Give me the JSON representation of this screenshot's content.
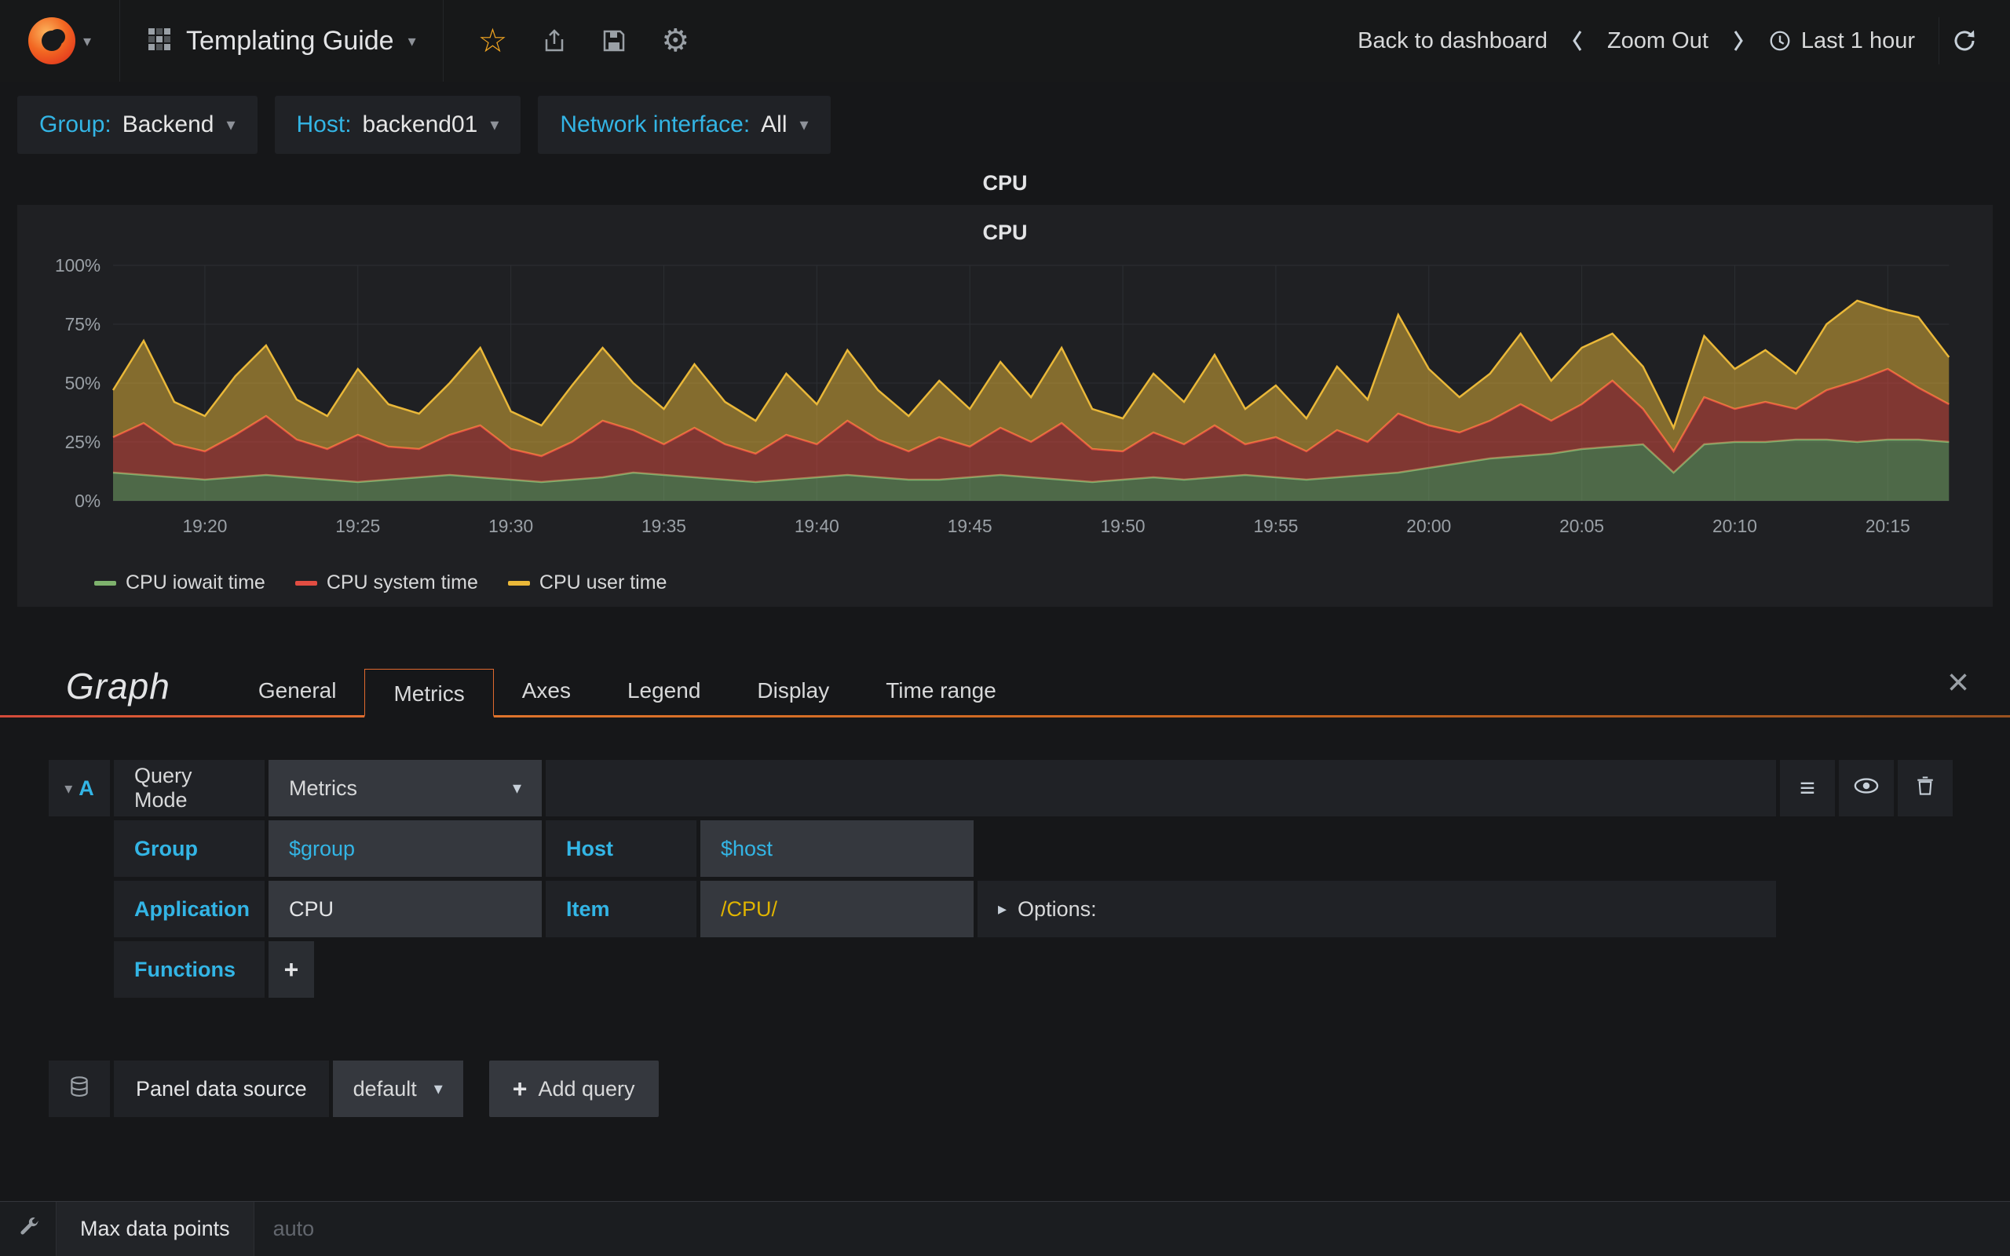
{
  "navbar": {
    "title": "Templating Guide",
    "back_to_dashboard": "Back to dashboard",
    "zoom_out": "Zoom Out",
    "time_range": "Last 1 hour"
  },
  "variables": [
    {
      "label": "Group:",
      "value": "Backend"
    },
    {
      "label": "Host:",
      "value": "backend01"
    },
    {
      "label": "Network interface:",
      "value": "All"
    }
  ],
  "panel": {
    "header_title": "CPU",
    "chart_title": "CPU"
  },
  "chart_data": {
    "type": "area",
    "stacked": true,
    "title": "CPU",
    "ylim": [
      0,
      100
    ],
    "y_ticks": [
      "0%",
      "25%",
      "50%",
      "75%",
      "100%"
    ],
    "x_tick_indices": [
      3,
      8,
      13,
      18,
      23,
      28,
      33,
      38,
      43,
      48,
      53,
      58
    ],
    "x_tick_labels": [
      "19:20",
      "19:25",
      "19:30",
      "19:35",
      "19:40",
      "19:45",
      "19:50",
      "19:55",
      "20:00",
      "20:05",
      "20:10",
      "20:15"
    ],
    "legend_position": "bottom-left",
    "grid": true,
    "series": [
      {
        "name": "CPU iowait time",
        "color": "#7eb26d",
        "values": [
          12,
          11,
          10,
          9,
          10,
          11,
          10,
          9,
          8,
          9,
          10,
          11,
          10,
          9,
          8,
          9,
          10,
          12,
          11,
          10,
          9,
          8,
          9,
          10,
          11,
          10,
          9,
          9,
          10,
          11,
          10,
          9,
          8,
          9,
          10,
          9,
          10,
          11,
          10,
          9,
          10,
          11,
          12,
          14,
          16,
          18,
          19,
          20,
          22,
          23,
          24,
          12,
          24,
          25,
          25,
          26,
          26,
          25,
          26,
          26,
          25
        ]
      },
      {
        "name": "CPU system time",
        "color": "#e24d42",
        "values": [
          15,
          22,
          14,
          12,
          18,
          25,
          16,
          13,
          20,
          14,
          12,
          17,
          22,
          13,
          11,
          16,
          24,
          18,
          13,
          21,
          15,
          12,
          19,
          14,
          23,
          16,
          12,
          18,
          13,
          20,
          15,
          24,
          14,
          12,
          19,
          15,
          22,
          13,
          17,
          12,
          20,
          14,
          25,
          18,
          13,
          16,
          22,
          14,
          19,
          28,
          15,
          9,
          20,
          14,
          17,
          13,
          21,
          26,
          30,
          22,
          16
        ]
      },
      {
        "name": "CPU user time",
        "color": "#eab839",
        "values": [
          20,
          35,
          18,
          15,
          25,
          30,
          17,
          14,
          28,
          18,
          15,
          22,
          33,
          16,
          13,
          24,
          31,
          20,
          15,
          27,
          18,
          14,
          26,
          17,
          30,
          21,
          15,
          24,
          16,
          28,
          19,
          32,
          17,
          14,
          25,
          18,
          30,
          15,
          22,
          14,
          27,
          18,
          42,
          24,
          15,
          20,
          30,
          17,
          24,
          20,
          18,
          10,
          26,
          17,
          22,
          15,
          28,
          34,
          25,
          30,
          20
        ]
      }
    ]
  },
  "editor": {
    "panel_type": "Graph",
    "tabs": [
      "General",
      "Metrics",
      "Axes",
      "Legend",
      "Display",
      "Time range"
    ],
    "active_tab": "Metrics",
    "query": {
      "ref": "A",
      "mode_label": "Query Mode",
      "mode_value": "Metrics",
      "group_label": "Group",
      "group_value": "$group",
      "host_label": "Host",
      "host_value": "$host",
      "application_label": "Application",
      "application_value": "CPU",
      "item_label": "Item",
      "item_value": "/CPU/",
      "options_label": "Options:",
      "functions_label": "Functions"
    },
    "datasource": {
      "label": "Panel data source",
      "value": "default",
      "add_query_label": "Add query"
    },
    "max_data_points": {
      "label": "Max data points",
      "placeholder": "auto"
    }
  },
  "colors": {
    "accent_blue": "#33b5e5",
    "tab_orange": "#e0692e",
    "item_yellow": "#e0b400",
    "background": "#161719",
    "cell_background": "#202226"
  }
}
